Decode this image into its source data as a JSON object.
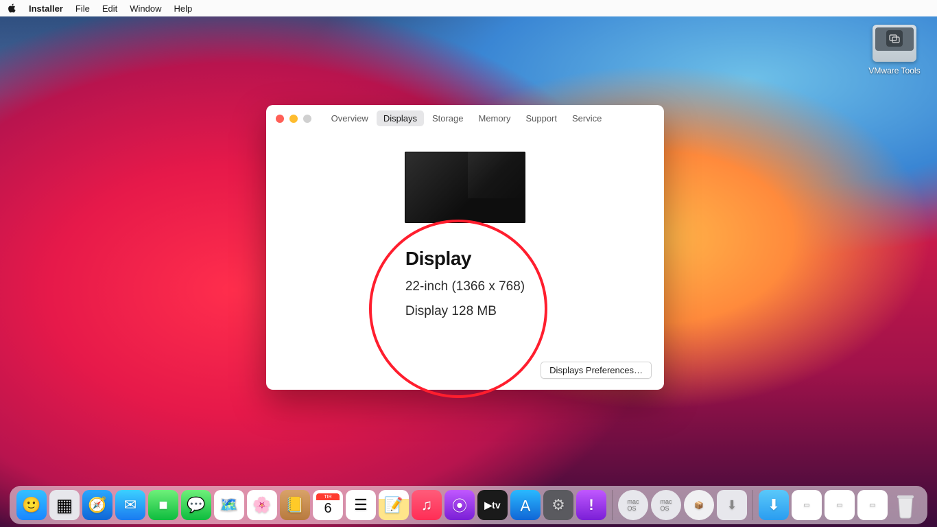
{
  "menubar": {
    "app": "Installer",
    "items": [
      "File",
      "Edit",
      "Window",
      "Help"
    ]
  },
  "desktop": {
    "icons": [
      {
        "label": "VMware Tools"
      }
    ]
  },
  "window": {
    "tabs": [
      "Overview",
      "Displays",
      "Storage",
      "Memory",
      "Support",
      "Service"
    ],
    "active_tab_index": 1,
    "display": {
      "heading": "Display",
      "size_line": "22-inch (1366 x 768)",
      "graphics_line": "Display 128 MB"
    },
    "prefs_button": "Displays Preferences…"
  },
  "dock": {
    "items_left": [
      "finder",
      "launchpad",
      "safari",
      "mail",
      "facetime",
      "messages",
      "maps",
      "photos",
      "contacts",
      "calendar",
      "reminders",
      "notes",
      "music",
      "podcasts",
      "tv",
      "appstore",
      "systemprefs",
      "feedback"
    ],
    "calendar": {
      "month_label": "TIR",
      "day": "6"
    },
    "items_mid": [
      "macos-disk-a",
      "macos-disk-b",
      "macos-installer",
      "minimized-1"
    ],
    "items_right": [
      "downloads-folder",
      "window-thumb-1",
      "window-thumb-2",
      "window-thumb-3",
      "trash"
    ]
  }
}
